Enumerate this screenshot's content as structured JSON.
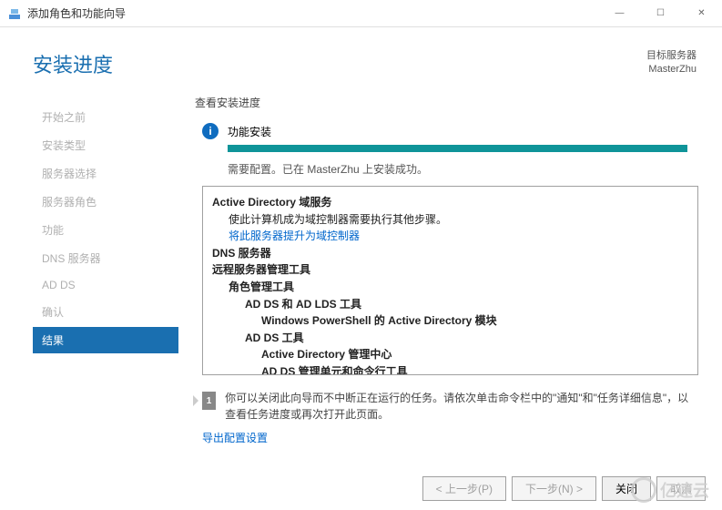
{
  "window": {
    "title": "添加角色和功能向导",
    "minimize": "—",
    "maximize": "☐",
    "close": "✕"
  },
  "header": {
    "page_title": "安装进度",
    "target_label": "目标服务器",
    "target_value": "MasterZhu"
  },
  "sidebar": {
    "items": [
      {
        "label": "开始之前"
      },
      {
        "label": "安装类型"
      },
      {
        "label": "服务器选择"
      },
      {
        "label": "服务器角色"
      },
      {
        "label": "功能"
      },
      {
        "label": "DNS 服务器"
      },
      {
        "label": "AD DS"
      },
      {
        "label": "确认"
      },
      {
        "label": "结果",
        "active": true
      }
    ]
  },
  "main": {
    "view_label": "查看安装进度",
    "install_label": "功能安装",
    "status_text": "需要配置。已在 MasterZhu 上安装成功。",
    "details": {
      "ad_ds_title": "Active Directory 域服务",
      "ad_ds_desc": "使此计算机成为域控制器需要执行其他步骤。",
      "promote_link": "将此服务器提升为域控制器",
      "dns_title": "DNS 服务器",
      "rsat_title": "远程服务器管理工具",
      "role_tools": "角色管理工具",
      "adds_lds_tools": "AD DS 和 AD LDS 工具",
      "powershell_module": "Windows PowerShell 的 Active Directory 模块",
      "adds_tools": "AD DS 工具",
      "ad_admin_center": "Active Directory 管理中心",
      "adds_snapins": "AD DS 管理单元和命令行工具"
    },
    "note_text": "你可以关闭此向导而不中断正在运行的任务。请依次单击命令栏中的\"通知\"和\"任务详细信息\"，以查看任务进度或再次打开此页面。",
    "export_link": "导出配置设置"
  },
  "footer": {
    "prev": "< 上一步(P)",
    "next": "下一步(N) >",
    "close": "关闭",
    "cancel": "取消"
  },
  "watermark": "亿速云"
}
